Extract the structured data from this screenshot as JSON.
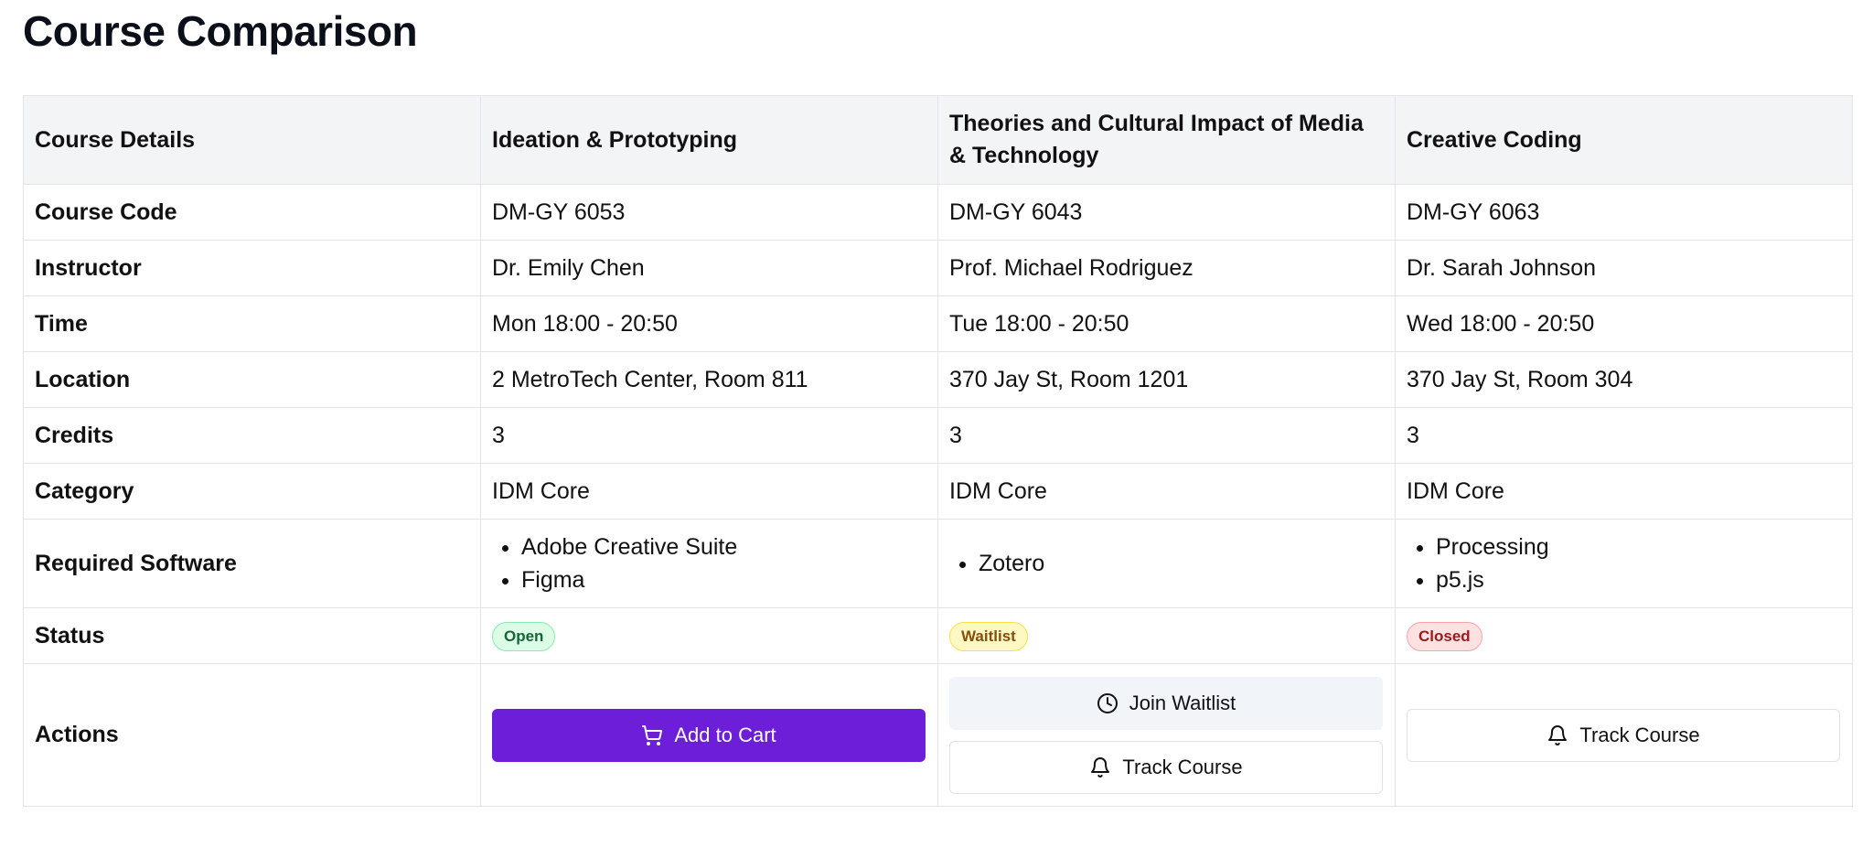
{
  "page": {
    "title": "Course Comparison"
  },
  "table": {
    "headers": [
      "Course Details",
      "Ideation & Prototyping",
      "Theories and Cultural Impact of Media & Technology",
      "Creative Coding"
    ],
    "rows": {
      "code": {
        "label": "Course Code",
        "values": [
          "DM-GY 6053",
          "DM-GY 6043",
          "DM-GY 6063"
        ]
      },
      "instructor": {
        "label": "Instructor",
        "values": [
          "Dr. Emily Chen",
          "Prof. Michael Rodriguez",
          "Dr. Sarah Johnson"
        ]
      },
      "time": {
        "label": "Time",
        "values": [
          "Mon 18:00 - 20:50",
          "Tue 18:00 - 20:50",
          "Wed 18:00 - 20:50"
        ]
      },
      "location": {
        "label": "Location",
        "values": [
          "2 MetroTech Center, Room 811",
          "370 Jay St, Room 1201",
          "370 Jay St, Room 304"
        ]
      },
      "credits": {
        "label": "Credits",
        "values": [
          "3",
          "3",
          "3"
        ]
      },
      "category": {
        "label": "Category",
        "values": [
          "IDM Core",
          "IDM Core",
          "IDM Core"
        ]
      },
      "software": {
        "label": "Required Software",
        "values": [
          [
            "Adobe Creative Suite",
            "Figma"
          ],
          [
            "Zotero"
          ],
          [
            "Processing",
            "p5.js"
          ]
        ]
      },
      "status": {
        "label": "Status",
        "values": [
          "Open",
          "Waitlist",
          "Closed"
        ]
      },
      "actions": {
        "label": "Actions",
        "add_to_cart": "Add to Cart",
        "join_waitlist": "Join Waitlist",
        "track_course": "Track Course"
      }
    }
  },
  "colors": {
    "primary": "#6d1ed9",
    "open": "#166534",
    "waitlist": "#854d0e",
    "closed": "#991b1b"
  },
  "icons": {
    "cart": "cart-icon",
    "clock": "clock-icon",
    "bell": "bell-icon"
  }
}
